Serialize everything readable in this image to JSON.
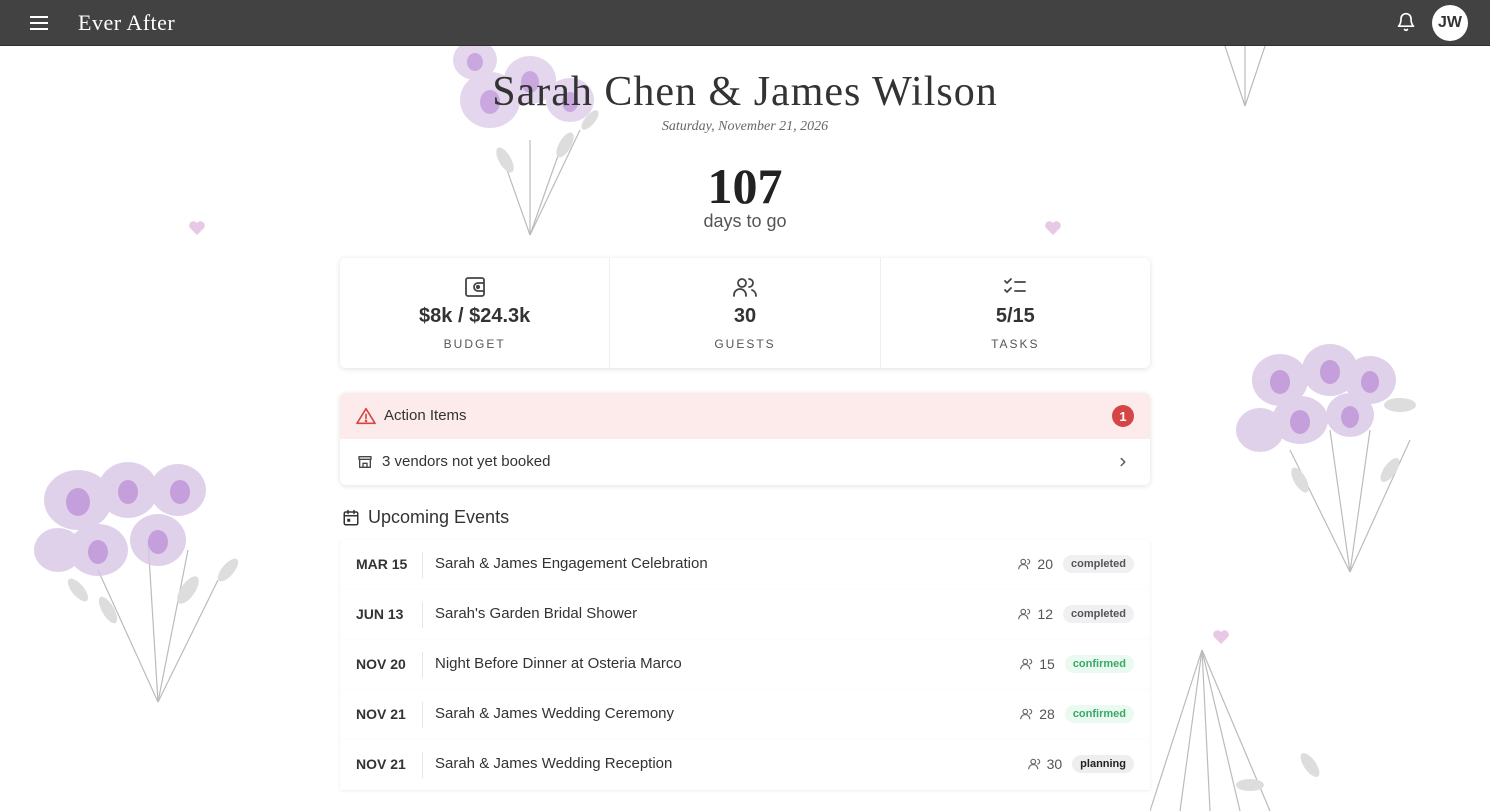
{
  "app": {
    "title": "Ever After",
    "user_initials": "JW"
  },
  "icons": {
    "menu": "menu-icon",
    "bell": "bell-icon",
    "budget": "wallet-icon",
    "guests": "people-icon",
    "tasks": "checklist-icon",
    "alert": "warning-icon",
    "vendor": "store-icon",
    "events": "calendar-icon"
  },
  "hero": {
    "couple": "Sarah Chen & James Wilson",
    "date": "Saturday, November 21, 2026",
    "days_count": "107",
    "days_label": "days to go"
  },
  "stats": [
    {
      "value": "$8k / $24.3k",
      "label": "BUDGET"
    },
    {
      "value": "30",
      "label": "GUESTS"
    },
    {
      "value": "5/15",
      "label": "TASKS"
    }
  ],
  "action_items": {
    "title": "Action Items",
    "count": "1",
    "items": [
      {
        "text": "3 vendors not yet booked"
      }
    ]
  },
  "events": {
    "title": "Upcoming Events",
    "items": [
      {
        "date": "MAR 15",
        "name": "Sarah & James Engagement Celebration",
        "guests": "20",
        "status": "completed"
      },
      {
        "date": "JUN 13",
        "name": "Sarah's Garden Bridal Shower",
        "guests": "12",
        "status": "completed"
      },
      {
        "date": "NOV 20",
        "name": "Night Before Dinner at Osteria Marco",
        "guests": "15",
        "status": "confirmed"
      },
      {
        "date": "NOV 21",
        "name": "Sarah & James Wedding Ceremony",
        "guests": "28",
        "status": "confirmed"
      },
      {
        "date": "NOV 21",
        "name": "Sarah & James Wedding Reception",
        "guests": "30",
        "status": "planning"
      }
    ]
  },
  "colors": {
    "topbar": "#424242",
    "alert_bg": "#fcebea",
    "badge": "#d64545",
    "confirmed": "#3aa866",
    "flower": "#b98ad6"
  }
}
